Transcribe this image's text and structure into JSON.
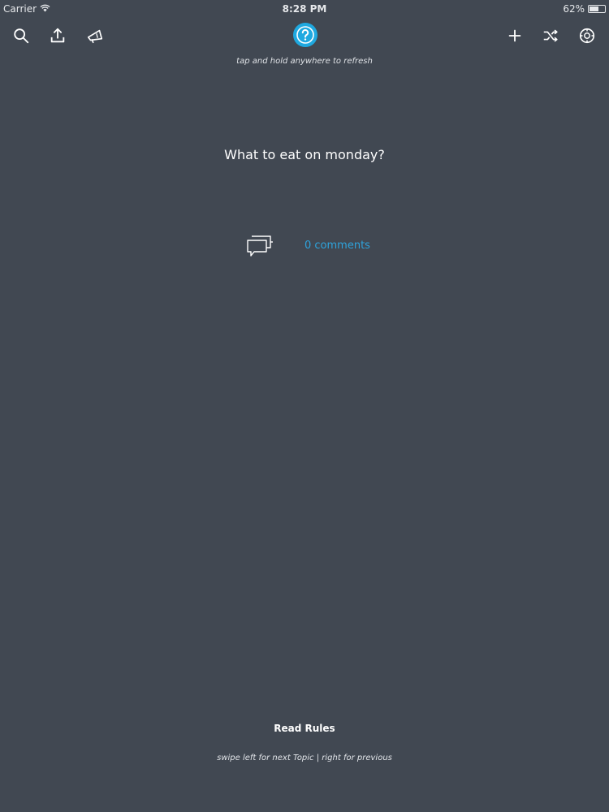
{
  "status_bar": {
    "carrier": "Carrier",
    "time": "8:28 PM",
    "battery": "62%",
    "battery_level": 0.62
  },
  "toolbar": {
    "left_icons": [
      "search-icon",
      "share-icon",
      "megaphone-icon"
    ],
    "center_icon": "question-icon",
    "right_icons": [
      "plus-icon",
      "shuffle-icon",
      "settings-icon"
    ],
    "accent_color": "#1fa9e0"
  },
  "refresh_hint": "tap and hold anywhere to refresh",
  "main": {
    "question": "What to eat on monday?",
    "comments_label": "0 comments",
    "link_color": "#2ea3dc"
  },
  "footer": {
    "read_rules": "Read Rules",
    "swipe_hint": "swipe left for next Topic | right for previous"
  },
  "colors": {
    "background": "#414852"
  }
}
